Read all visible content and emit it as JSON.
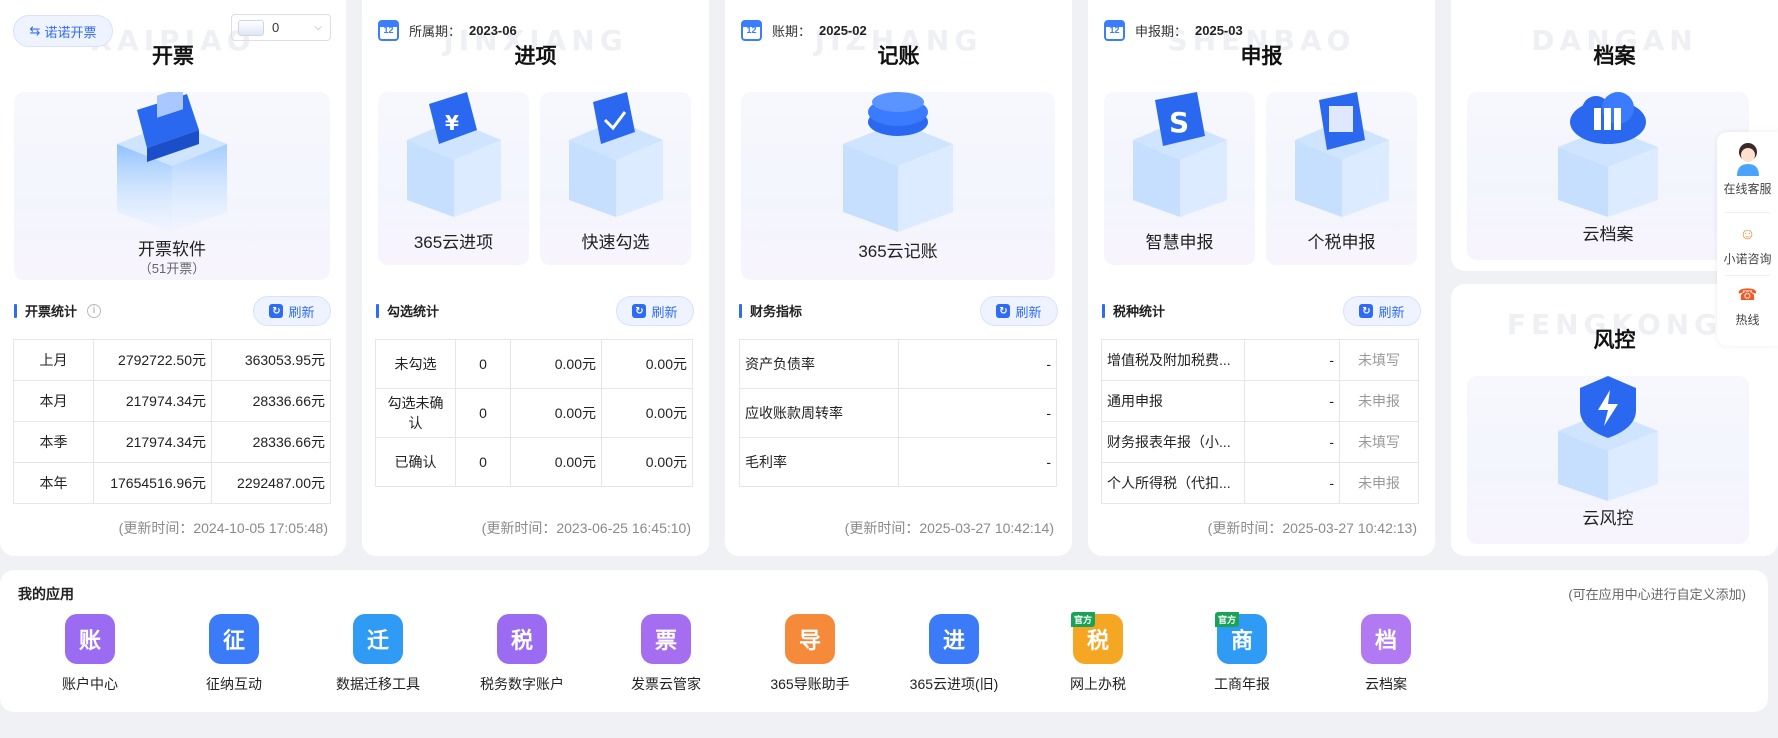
{
  "invoice": {
    "wm": "XAIPIAO",
    "switch_btn": "诺诺开票",
    "select_value": "0",
    "title": "开票",
    "hero_name": "开票软件",
    "hero_sub": "（51开票）",
    "section": "开票统计",
    "refresh": "刷新",
    "rows": [
      {
        "label": "上月",
        "amount": "2792722.50元",
        "tax": "363053.95元"
      },
      {
        "label": "本月",
        "amount": "217974.34元",
        "tax": "28336.66元"
      },
      {
        "label": "本季",
        "amount": "217974.34元",
        "tax": "28336.66元"
      },
      {
        "label": "本年",
        "amount": "17654516.96元",
        "tax": "2292487.00元"
      }
    ],
    "updated": "(更新时间：2024-10-05 17:05:48)"
  },
  "incoming": {
    "wm": "JINXIANG",
    "period_label": "所属期：",
    "period_value": "2023-06",
    "title": "进项",
    "hero1": "365云进项",
    "hero2": "快速勾选",
    "section": "勾选统计",
    "refresh": "刷新",
    "rows": [
      {
        "label": "未勾选",
        "count": "0",
        "amount": "0.00元",
        "tax": "0.00元"
      },
      {
        "label": "勾选未确认",
        "count": "0",
        "amount": "0.00元",
        "tax": "0.00元"
      },
      {
        "label": "已确认",
        "count": "0",
        "amount": "0.00元",
        "tax": "0.00元"
      }
    ],
    "updated": "(更新时间：2023-06-25 16:45:10)"
  },
  "bookkeeping": {
    "wm": "JIZHANG",
    "period_label": "账期：",
    "period_value": "2025-02",
    "title": "记账",
    "hero": "365云记账",
    "section": "财务指标",
    "refresh": "刷新",
    "rows": [
      {
        "label": "资产负债率",
        "value": "-"
      },
      {
        "label": "应收账款周转率",
        "value": "-"
      },
      {
        "label": "毛利率",
        "value": "-"
      }
    ],
    "updated": "(更新时间：2025-03-27 10:42:14)"
  },
  "filing": {
    "wm": "SHENBAO",
    "period_label": "申报期：",
    "period_value": "2025-03",
    "title": "申报",
    "hero1": "智慧申报",
    "hero2": "个税申报",
    "section": "税种统计",
    "refresh": "刷新",
    "rows": [
      {
        "label": "增值税及附加税费...",
        "value": "-",
        "status": "未填写"
      },
      {
        "label": "通用申报",
        "value": "-",
        "status": "未申报"
      },
      {
        "label": "财务报表年报（小...",
        "value": "-",
        "status": "未填写"
      },
      {
        "label": "个人所得税（代扣...",
        "value": "-",
        "status": "未申报"
      }
    ],
    "updated": "(更新时间：2025-03-27 10:42:13)"
  },
  "archive": {
    "wm": "DANGAN",
    "title": "档案",
    "hero": "云档案"
  },
  "risk": {
    "wm": "FENGKONG",
    "title": "风控",
    "hero": "云风控"
  },
  "side": {
    "online": "在线客服",
    "assistant": "小诺咨询",
    "hotline": "热线"
  },
  "apps": {
    "title": "我的应用",
    "hint": "(可在应用中心进行自定义添加)",
    "badge": "官方",
    "items": [
      {
        "label": "账户中心",
        "icon": "账",
        "color": "#9b6cf2"
      },
      {
        "label": "征纳互动",
        "icon": "征",
        "color": "#3b7bf7"
      },
      {
        "label": "数据迁移工具",
        "icon": "迁",
        "color": "#2f9bf5"
      },
      {
        "label": "税务数字账户",
        "icon": "税",
        "color": "#9b6cf2"
      },
      {
        "label": "发票云管家",
        "icon": "票",
        "color": "#a56ef0"
      },
      {
        "label": "365导账助手",
        "icon": "导",
        "color": "#f58a3a"
      },
      {
        "label": "365云进项(旧)",
        "icon": "进",
        "color": "#3b7bf7"
      },
      {
        "label": "网上办税",
        "icon": "税",
        "color": "#f5a623"
      },
      {
        "label": "工商年报",
        "icon": "商",
        "color": "#2f9bf5"
      },
      {
        "label": "云档案",
        "icon": "档",
        "color": "#b27af2"
      }
    ]
  }
}
